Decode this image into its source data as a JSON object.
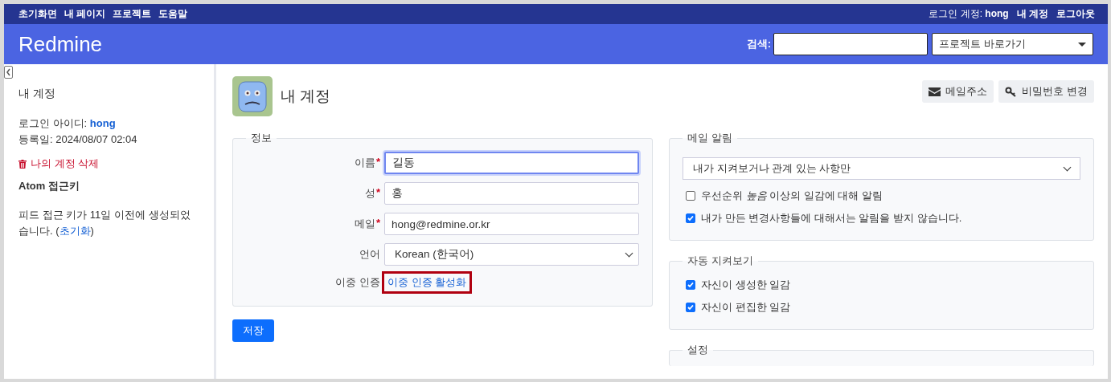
{
  "top_menu": {
    "items": [
      "초기화면",
      "내 페이지",
      "프로젝트",
      "도움말"
    ],
    "logged_in_label": "로그인 계정:",
    "logged_in_user": "hong",
    "account_links": [
      "내 계정",
      "로그아웃"
    ]
  },
  "header": {
    "title": "Redmine",
    "search_label": "검색:",
    "project_jump": "프로젝트 바로가기"
  },
  "sidebar": {
    "title": "내 계정",
    "login_label": "로그인 아이디:",
    "login": "hong",
    "registered": "등록일: 2024/08/07 02:04",
    "delete_link": "나의 계정 삭제",
    "atom_title": "Atom 접근키",
    "atom_text": "피드 접근 키가 11일 이전에 생성되었습니다. (",
    "atom_link": "초기화",
    "atom_after": ")"
  },
  "page": {
    "title": "내 계정",
    "actions": [
      {
        "kind": "mail",
        "label": "메일주소"
      },
      {
        "kind": "key",
        "label": "비밀번호 변경"
      }
    ]
  },
  "info": {
    "legend": "정보",
    "fields": [
      {
        "kind": "text",
        "label": "이름",
        "required_mark": "*",
        "value": "길동",
        "focused": true
      },
      {
        "kind": "text",
        "label": "성",
        "required_mark": "*",
        "value": "홍",
        "focused": false
      },
      {
        "kind": "text",
        "label": "메일",
        "required_mark": "*",
        "value": "hong@redmine.or.kr",
        "focused": false
      },
      {
        "kind": "select",
        "label": "언어",
        "value": "Korean (한국어)",
        "focused": false
      },
      {
        "kind": "link",
        "label": "이중 인증",
        "value": "이중 인증 활성화",
        "highlighted": true
      }
    ]
  },
  "save_button": "저장",
  "mail_notification": {
    "legend": "메일 알림",
    "select": "내가 지켜보거나 관계 있는 사항만",
    "options": [
      {
        "label": "우선순위 *높음* 이상의 일감에 대해 알림",
        "checked": false
      },
      {
        "label": "내가 만든 변경사항들에 대해서는 알림을 받지 않습니다.",
        "checked": true
      }
    ]
  },
  "auto_watch": {
    "legend": "자동 지켜보기",
    "options": [
      {
        "label": "자신이 생성한 일감",
        "checked": true
      },
      {
        "label": "자신이 편집한 일감",
        "checked": true
      }
    ]
  },
  "preferences": {
    "legend": "설정"
  }
}
